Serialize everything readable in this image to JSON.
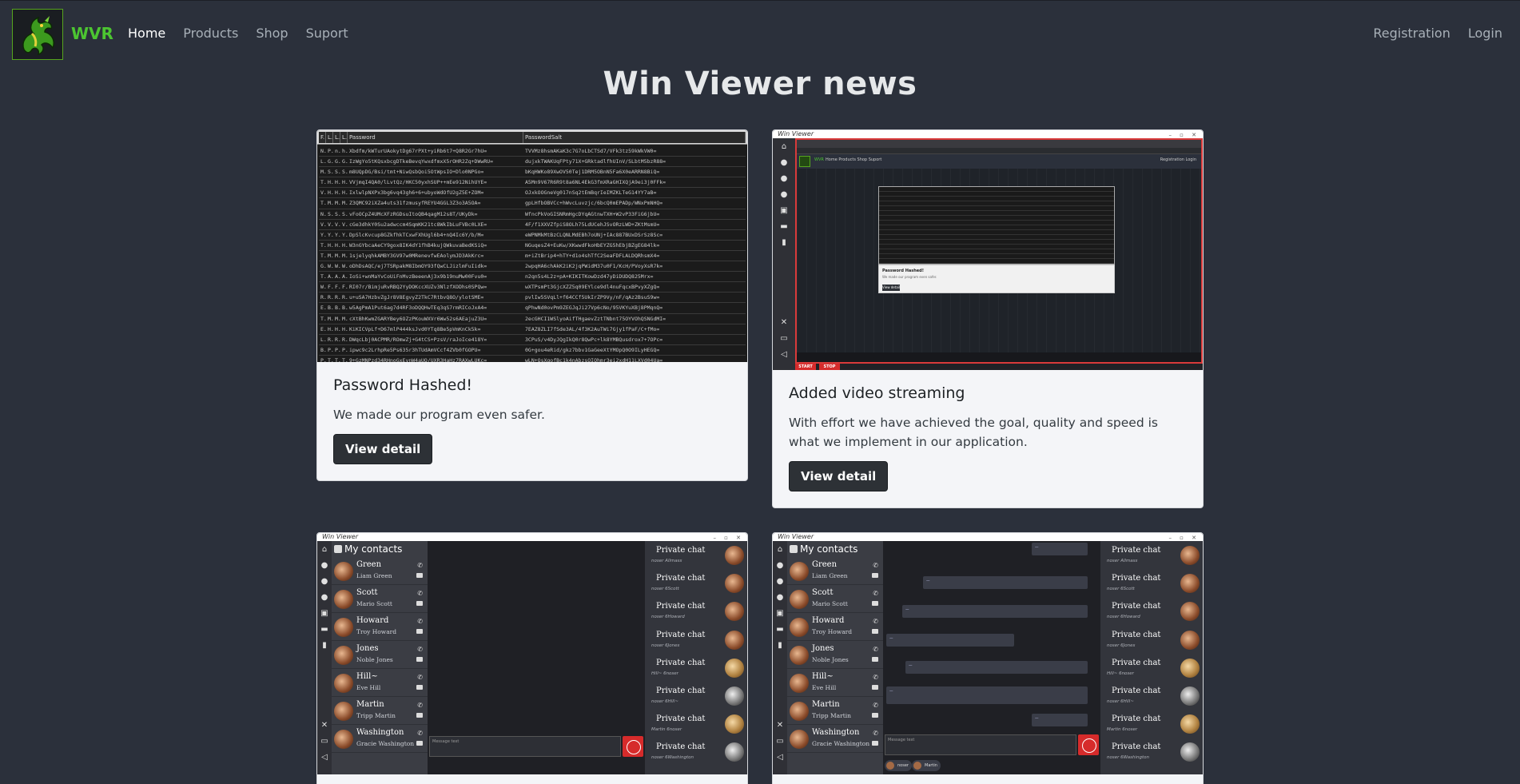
{
  "navbar": {
    "brand": "WVR",
    "links": [
      "Home",
      "Products",
      "Shop",
      "Suport"
    ],
    "right_links": [
      "Registration",
      "Login"
    ]
  },
  "page": {
    "title": "Win Viewer news"
  },
  "cards": [
    {
      "title": "Password Hashed!",
      "text": "We made our program even safer.",
      "button": "View detail",
      "screenshot": {
        "headers": [
          "F.",
          "L.",
          "L.",
          "L.",
          "Password",
          "PasswordSalt"
        ],
        "rows": [
          [
            "N.",
            "P...",
            "n.",
            "h.",
            "Xbdfm/kWTurUAokytDg67rPXt+yiRb6t7+Q8R2Gr7hU=",
            "TVVMz8hsmAKaK3c7G7oLbCTSd7/VFk3tz59kWkVW0="
          ],
          [
            "L.",
            "G.",
            "G.",
            "G.",
            "IzWgYo5tKQsxbcgDTkeBevqYwxdfmxX5rOHR2Zq+DWwRU=",
            "dujxkTWAKUqFPty71X+GRktadlfhUInV/SLbtM5bzR88="
          ],
          [
            "M.",
            "S.",
            "S.",
            "S.",
            "m8UQpDG/Bsi/tmt+NiwQsbQoi5OtWpsIO+Dlo0NPGo=",
            "bKqHWKo89XwOV50Tej1DRM5OBnN5Fa6X0eARRN8BiQ="
          ],
          [
            "T.",
            "H.",
            "H.",
            "H.",
            "VVjmqI4QA0/lLvtQz/HKC50yxhSUP++mEe912NihUYE=",
            "A5Mn9V67R6R9t8a6NL4EkG3fmXRaGHIXQjA9ei3j0FFk="
          ],
          [
            "V.",
            "H.",
            "H.",
            "H.",
            "IxlwlpNXPx3bg6vq43gh6+6+ubyoWdOfU2gZ5E+ZOM=",
            "OJxkOOGneVg017nSq2tEmBqrIeIMZKLTeG14YY7aB="
          ],
          [
            "T.",
            "M.",
            "M.",
            "M.",
            "Z3QMC92iXZa4uts31fzmusyfREYU4GGL3Z3o3A5OA=",
            "gpLHfbOBVCc+hWvcLuvzjc/6bcQ0mEPADp/WNxPmNHQ="
          ],
          [
            "N.",
            "S.",
            "S.",
            "S.",
            "vFoOCpZ4UMcXFzRGDsuItoQB4qagM12s8T/UKyDk=",
            "WfncPkVoGISNRmHgcDYqAGtnwTXH+W2vP33FiG6jbU="
          ],
          [
            "V.",
            "V.",
            "V.",
            "V.",
            "cGe3dhkY0Su2adwccm4SqmKK21tc8WkIbLuFVBc0LXE=",
            "4F/f1XXVZfpiS8OLh75LdUCehJSvORzLWD+ZKtMsmU="
          ],
          [
            "Y.",
            "Y.",
            "Y.",
            "Y.",
            "DpSlcKvcup8GZkfhkTCxwFXhUgl6b4+nQ4Ic6Y/b/M=",
            "eWPNMkMtBzCLQNLMdEBh7oUNj+IAc887BUxDSrSz8Sc="
          ],
          [
            "T.",
            "H.",
            "H.",
            "H.",
            "W3nGYbcaAeCY9gox8IK4dY1fhB4kujQWkuvaBedKSiQ=",
            "NGuqesZ4+EuKw/XKwwdFkoHbEYZG5hEbjBZgEG84lk="
          ],
          [
            "T.",
            "M.",
            "M.",
            "M.",
            "1sjelyqhkAMBY3GV97w0MRenevfwEAolymJD3AkKrc=",
            "m+iZtBrip4+hTY+d1o4shTfC2SeaFDFLALDQRhsmX4="
          ],
          [
            "G.",
            "W.",
            "W.",
            "W.",
            "oDhDsAQC/ej7TSRpakM8IbmOY93fQwCLJizlmFuIidk=",
            "2wpqHA6chAkK2iK2jqPWidM37u0F1/KcH/PVoyXsR7k="
          ],
          [
            "T.",
            "A.",
            "A.",
            "A.",
            "IoSi+wnMaYvCoUiFnMvzBeeenAj3x9b19nuMw00Fvu0=",
            "n2qn5s4L2z+pA+KIKITKowDzd47yDiDUDQ825Mrx="
          ],
          [
            "W.",
            "F.",
            "F.",
            "F.",
            "RI07r/BimjuRvRBQ2YyDOKccXUZv3NlzfXODhs0SPQw=",
            "wXTPsmPt3GjcXZZ5q09EYlce9dl4nuFqcxBPvyXZgQ="
          ],
          [
            "R.",
            "R.",
            "R.",
            "R.",
            "u+uSA7HzbvZgJr8V8EgvyZ2TkC7RtbvQ8O/ylotSME=",
            "pvlIw5SVqLl+f64CCf5UkIrZP9Vy/nF/qAz2BsuS9w="
          ],
          [
            "E.",
            "B.",
            "B.",
            "B.",
            "w5AgPmA1Put6ag7d4RF3oDQQHwTEq3qS7rmRICoJxA4=",
            "qPhwNd0ovPm9ZEGJqJi27Vp6cNo/95VKYuXBj8PMqnQ="
          ],
          [
            "T.",
            "M.",
            "M.",
            "M.",
            "cXtBhKwmZGARYBey6OZzPKouWXVr6Ww52s6AEajuZ3U=",
            "2ecGHCI1WSlyoAifTHgaevZztTNbnt75OYVOhQSNGdMI="
          ],
          [
            "E.",
            "H.",
            "H.",
            "H.",
            "KiKICVpLf+D67mlP444ksJvd0YTq8Be5pVmKnCk5k=",
            "7EAZ8ZLI7fSde3AL/4f3K2AuTWi7Gjy1fPaF/C+fMo="
          ],
          [
            "L.",
            "R.",
            "R.",
            "R.",
            "DWqcLbj0ACPMR/ROmwZj+G4tCS+PzsV/raJoIce418Y=",
            "3CPuS/v4DyJQgIkQ0r8QwPc+lk8YMBQusdrox7+7OPc="
          ],
          [
            "B.",
            "P.",
            "P.",
            "P.",
            "ipwc9c2LrhpRe5Ps635r3hTUdAmVCcf4ZVb0fGOPU=",
            "0G+gou4eRid/gkz7bbv1GaGeeXtYMOpQ0O9ILyHEGQ="
          ],
          [
            "P.",
            "T.",
            "T.",
            "T.",
            "9+GzMNPzd34RHnoGxEynW4aUQ/UXR3HaHz7RAXwLUKc=",
            "wLN+QsXgofBc1k4nAbzsOIQhmr3ei2xdH11LXVd04Ua="
          ]
        ]
      }
    },
    {
      "title": "Added video streaming",
      "text": "With effort we have achieved the goal, quality and speed is what we implement in our application.",
      "button": "View detail",
      "screenshot": {
        "window_title": "Win Viewer",
        "mini_brand": "WVR",
        "mini_links": "Home  Products  Shop  Suport",
        "mini_right": "Registration  Login",
        "modal_title": "Password Hashed!",
        "modal_text": "We made our program even safer.",
        "modal_button": "View detail",
        "start_label": "START",
        "stop_label": "STOP"
      }
    }
  ],
  "chat_cards": [
    {
      "window_title": "Win Viewer",
      "contacts_header": "My contacts",
      "contacts": [
        {
          "name": "Green",
          "sub": "Liam Green"
        },
        {
          "name": "Scott",
          "sub": "Mario Scott"
        },
        {
          "name": "Howard",
          "sub": "Troy Howard"
        },
        {
          "name": "Jones",
          "sub": "Noble Jones"
        },
        {
          "name": "Hill~",
          "sub": "Eve Hill"
        },
        {
          "name": "Martin",
          "sub": "Tripp Martin"
        },
        {
          "name": "Washington",
          "sub": "Gracie Washington"
        }
      ],
      "input_placeholder": "Message text",
      "private_chats": [
        {
          "title": "Private chat",
          "sub": "noser Allmass"
        },
        {
          "title": "Private chat",
          "sub": "noser 6Scott"
        },
        {
          "title": "Private chat",
          "sub": "noser 6Howard"
        },
        {
          "title": "Private chat",
          "sub": "noser 6Jones"
        },
        {
          "title": "Private chat",
          "sub": "Hill~ 6noser"
        },
        {
          "title": "Private chat",
          "sub": "noser 6Hill~"
        },
        {
          "title": "Private chat",
          "sub": "Martin 6noser"
        },
        {
          "title": "Private chat",
          "sub": "noser 6Washington"
        }
      ]
    },
    {
      "window_title": "Win Viewer",
      "contacts_header": "My contacts",
      "contacts": [
        {
          "name": "Green",
          "sub": "Liam Green"
        },
        {
          "name": "Scott",
          "sub": "Mario Scott"
        },
        {
          "name": "Howard",
          "sub": "Troy Howard"
        },
        {
          "name": "Jones",
          "sub": "Noble Jones"
        },
        {
          "name": "Hill~",
          "sub": "Eve Hill"
        },
        {
          "name": "Martin",
          "sub": "Tripp Martin"
        },
        {
          "name": "Washington",
          "sub": "Gracie Washington"
        }
      ],
      "input_placeholder": "Message text",
      "chips": [
        "noser",
        "Martin"
      ],
      "private_chats": [
        {
          "title": "Private chat",
          "sub": "noser Allmass"
        },
        {
          "title": "Private chat",
          "sub": "noser 6Scott"
        },
        {
          "title": "Private chat",
          "sub": "noser 6Howard"
        },
        {
          "title": "Private chat",
          "sub": "noser 6Jones"
        },
        {
          "title": "Private chat",
          "sub": "Hill~ 6noser"
        },
        {
          "title": "Private chat",
          "sub": "noser 6Hill~"
        },
        {
          "title": "Private chat",
          "sub": "Martin 6noser"
        },
        {
          "title": "Private chat",
          "sub": "noser 6Washington"
        }
      ]
    }
  ]
}
